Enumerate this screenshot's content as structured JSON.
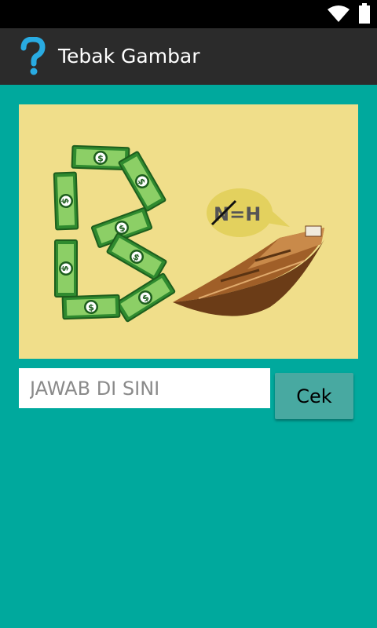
{
  "app": {
    "title": "Tebak Gambar"
  },
  "puzzle": {
    "bubble_text": "N=H"
  },
  "answer_input": {
    "value": "",
    "placeholder": "JAWAB DI SINI"
  },
  "check_button": {
    "label": "Cek"
  },
  "colors": {
    "background": "#00a99d",
    "action_bar": "#2b2b2b",
    "accent": "#29abe2",
    "puzzle_bg": "#f0de8a",
    "button": "#48a9a1"
  },
  "status_bar": {
    "icons": [
      "wifi-icon",
      "battery-icon"
    ]
  }
}
